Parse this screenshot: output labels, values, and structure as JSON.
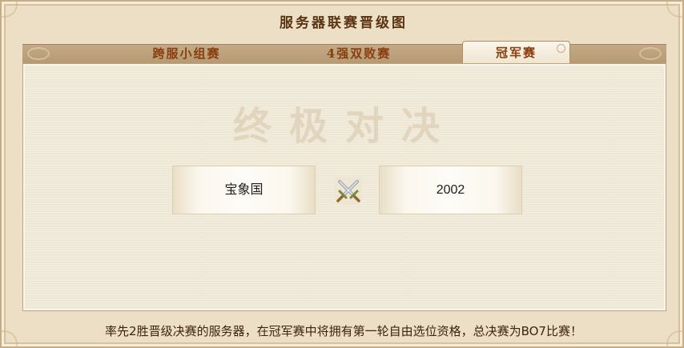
{
  "window": {
    "title": "服务器联赛晋级图"
  },
  "tabs": [
    {
      "label": "跨服小组赛",
      "active": false
    },
    {
      "label": "4强双败赛",
      "active": false
    },
    {
      "label": "冠军赛",
      "active": true
    }
  ],
  "panel": {
    "heading": "终极对决",
    "match": {
      "left_team": "宝象国",
      "right_team": "2002",
      "vs_icon": "crossed-swords-icon"
    }
  },
  "footer": {
    "note": "率先2胜晋级决赛的服务器，在冠军赛中将拥有第一轮自由选位资格，总决赛为BO7比赛！"
  },
  "colors": {
    "background": "#ecdfc6",
    "tab_text": "#8a3e0d",
    "title_text": "#5b3513",
    "active_tab": "#fbf6ea"
  }
}
